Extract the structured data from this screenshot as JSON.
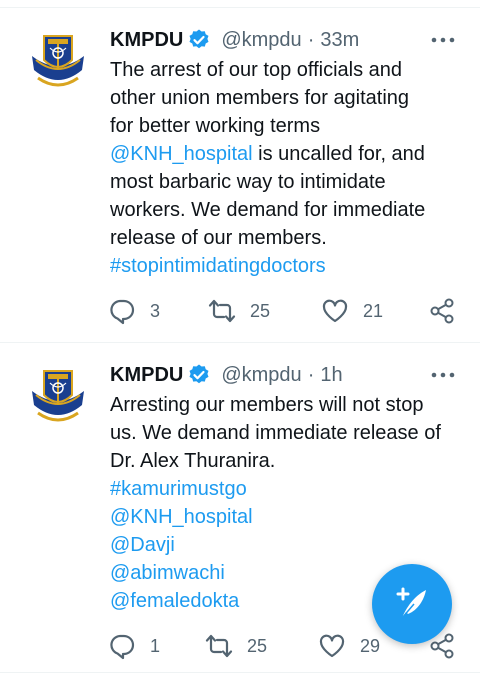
{
  "tweets": [
    {
      "name": "KMPDU",
      "handle": "@kmpdu",
      "separator": "·",
      "time": "33m",
      "text_lines": [
        {
          "segments": [
            {
              "text": "The arrest of our top officials and",
              "link": false
            }
          ]
        },
        {
          "segments": [
            {
              "text": "other union members for agitating",
              "link": false
            }
          ]
        },
        {
          "segments": [
            {
              "text": "for better working terms",
              "link": false
            }
          ]
        },
        {
          "segments": [
            {
              "text": "@KNH_hospital",
              "link": true
            },
            {
              "text": " is uncalled for, and",
              "link": false
            }
          ]
        },
        {
          "segments": [
            {
              "text": "most barbaric way to intimidate",
              "link": false
            }
          ]
        },
        {
          "segments": [
            {
              "text": "workers. We demand for immediate",
              "link": false
            }
          ]
        },
        {
          "segments": [
            {
              "text": "release of our members.",
              "link": false
            }
          ]
        },
        {
          "segments": [
            {
              "text": "#stopintimidatingdoctors",
              "link": true
            }
          ]
        }
      ],
      "replies": "3",
      "retweets": "25",
      "likes": "21"
    },
    {
      "name": "KMPDU",
      "handle": "@kmpdu",
      "separator": "·",
      "time": "1h",
      "text_lines": [
        {
          "segments": [
            {
              "text": "Arresting our members will not stop",
              "link": false
            }
          ]
        },
        {
          "segments": [
            {
              "text": "us. We demand immediate release of",
              "link": false
            }
          ]
        },
        {
          "segments": [
            {
              "text": "Dr. Alex Thuranira.",
              "link": false
            }
          ]
        },
        {
          "segments": [
            {
              "text": "#kamurimustgo",
              "link": true
            }
          ]
        },
        {
          "segments": [
            {
              "text": "@KNH_hospital",
              "link": true
            }
          ]
        },
        {
          "segments": [
            {
              "text": "@Davji",
              "link": true
            }
          ]
        },
        {
          "segments": [
            {
              "text": "@abimwachi",
              "link": true
            }
          ]
        },
        {
          "segments": [
            {
              "text": "@femaledokta",
              "link": true
            }
          ]
        }
      ],
      "replies": "1",
      "retweets": "25",
      "likes": "29"
    }
  ],
  "icons": {
    "verified": "verified-badge-icon",
    "more": "more-horizontal-icon",
    "reply": "reply-icon",
    "retweet": "retweet-icon",
    "like": "heart-icon",
    "share": "share-icon",
    "compose": "compose-tweet-icon"
  },
  "colors": {
    "link": "#1d9bf0",
    "secondary_text": "#536471",
    "divider": "#eff3f4",
    "fab": "#1d9bf0",
    "avatar_shield": "#1a3f8f",
    "avatar_gold": "#d9a520"
  }
}
